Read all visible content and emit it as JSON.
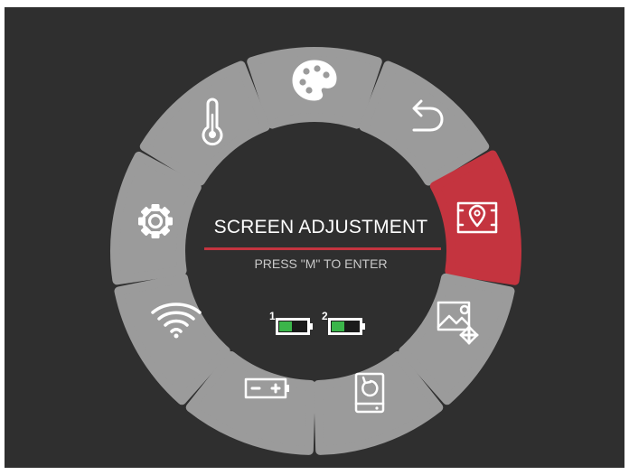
{
  "menu": {
    "title": "SCREEN ADJUSTMENT",
    "subtitle": "PRESS \"M\" TO ENTER",
    "selected": "screen-adjustment",
    "accent_color": "#c4343f",
    "segment_color": "#9b9b9b",
    "background_color": "#2f2f2f",
    "items": [
      {
        "id": "palette",
        "icon": "palette-icon"
      },
      {
        "id": "back",
        "icon": "back-arrow-icon"
      },
      {
        "id": "screen-adjustment",
        "icon": "screen-adjustment-icon"
      },
      {
        "id": "picture-move",
        "icon": "image-move-icon"
      },
      {
        "id": "reset",
        "icon": "restore-device-icon"
      },
      {
        "id": "battery-settings",
        "icon": "battery-minus-plus-icon"
      },
      {
        "id": "wifi",
        "icon": "wifi-icon"
      },
      {
        "id": "settings",
        "icon": "gear-icon"
      },
      {
        "id": "temperature",
        "icon": "thermometer-icon"
      }
    ]
  },
  "batteries": [
    {
      "label": "1",
      "color": "#3bb54a"
    },
    {
      "label": "2",
      "color": "#3bb54a"
    }
  ]
}
